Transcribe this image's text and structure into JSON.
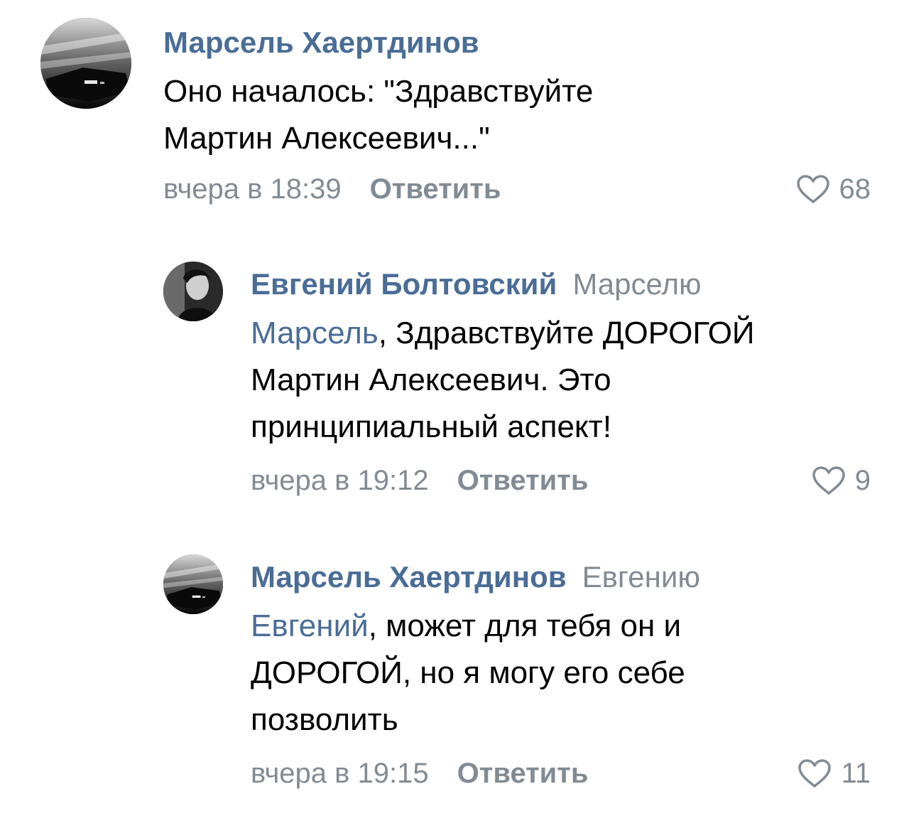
{
  "comments": [
    {
      "author": "Марсель Хаертдинов",
      "reply_to": "",
      "mention": "",
      "mention_sep": "",
      "text_lines": [
        "Оно началось: \"Здравствуйте",
        "Мартин Алексеевич...\""
      ],
      "time": "вчера в 18:39",
      "reply_label": "Ответить",
      "likes": "68",
      "avatar": "car-avatar"
    },
    {
      "author": "Евгений Болтовский",
      "reply_to": "Марселю",
      "mention": "Марсель",
      "mention_sep": ", Здравствуйте ДОРОГОЙ",
      "text_lines": [
        "Мартин Алексеевич. Это",
        "принципиальный аспект!"
      ],
      "time": "вчера в 19:12",
      "reply_label": "Ответить",
      "likes": "9",
      "avatar": "portrait-avatar"
    },
    {
      "author": "Марсель Хаертдинов",
      "reply_to": "Евгению",
      "mention": "Евгений",
      "mention_sep": ", может для тебя он и",
      "text_lines": [
        "ДОРОГОЙ, но я могу его себе",
        "позволить"
      ],
      "time": "вчера в 19:15",
      "reply_label": "Ответить",
      "likes": "11",
      "avatar": "car-avatar"
    }
  ],
  "colors": {
    "link": "#4a6d96",
    "muted": "#828b94",
    "text": "#000000",
    "background": "#ffffff"
  }
}
